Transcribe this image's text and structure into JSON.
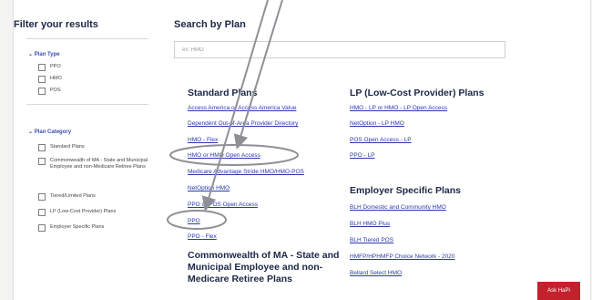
{
  "filters": {
    "title": "Filter your results",
    "plan_type": {
      "heading": "Plan Type",
      "options": [
        "PPO",
        "HMO",
        "POS"
      ]
    },
    "plan_category": {
      "heading": "Plan Category",
      "options": [
        "Standard Plans",
        "Commonwealth of MA - State and Municipal Employee and non-Medicare Retiree Plans",
        "Tiered/Limited Plans",
        "LP (Low-Cost Provider) Plans",
        "Employer Specific Plans"
      ]
    }
  },
  "search": {
    "title": "Search by Plan",
    "placeholder": "ex: HMO"
  },
  "standard_plans": {
    "title": "Standard Plans",
    "links": [
      "Access America or Access America Value",
      "Dependent Out-of-Area Provider Directory",
      "HMO - Flex",
      "HMO or HMO Open Access",
      "Medicare Advantage Stride HMO/HMO-POS",
      "NetOption HMO",
      "PPO or POS Open Access",
      "PPO",
      "PPO - Flex"
    ]
  },
  "lp_plans": {
    "title": "LP (Low-Cost Provider) Plans",
    "links": [
      "HMO - LP or HMO - LP Open Access",
      "NetOption - LP HMO",
      "POS Open Access - LP",
      "PPO - LP"
    ]
  },
  "employer_plans": {
    "title": "Employer Specific Plans",
    "links": [
      "BLH Domestic and Community HMO",
      "BLH HMO Plus",
      "BLH Tiered POS",
      "HMFP/HPHMFP Choice Network - 2020",
      "Bellard Select HMO"
    ]
  },
  "commonwealth": {
    "title": "Commonwealth of MA - State and Municipal Employee and non-Medicare Retiree Plans"
  },
  "ask_button": "Ask HaPi",
  "colors": {
    "link": "#2a3aa8",
    "heading": "#1b2746",
    "annotation": "#8f8f96",
    "ask_button_bg": "#c3222d"
  }
}
